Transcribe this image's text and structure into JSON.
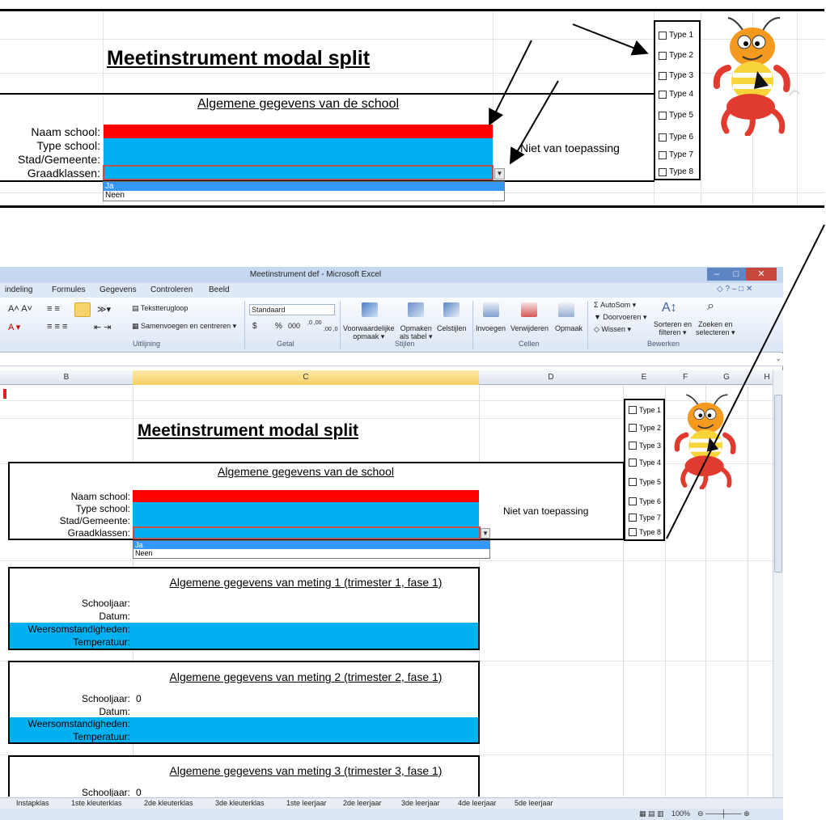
{
  "zoom": {
    "title": "Meetinstrument modal split",
    "section_title": "Algemene gegevens van de school",
    "labels": [
      "Naam school:",
      "Type school:",
      "Stad/Gemeente:",
      "Graadklassen:"
    ],
    "not_applicable": "Niet van toepassing",
    "dropdown_options": [
      "Ja",
      "Neen"
    ],
    "dropdown_arrow": "▼",
    "types": [
      "Type 1",
      "Type 2",
      "Type 3",
      "Type 4",
      "Type 5",
      "Type 6",
      "Type 7",
      "Type 8"
    ]
  },
  "window": {
    "title": "Meetinstrument def - Microsoft Excel",
    "controls": [
      "–",
      "□",
      "✕"
    ]
  },
  "menu": {
    "items": [
      "indeling",
      "Formules",
      "Gegevens",
      "Controleren",
      "Beeld"
    ]
  },
  "ribbon": {
    "wrap_text": "Tekstterugloop",
    "merge_center": "Samenvoegen en centreren",
    "number_format": "Standaard",
    "currency": "$",
    "percent": "%",
    "thousands": "000",
    "decimal_inc": ",0 ,00",
    "decimal_dec": ",00 ,0",
    "conditional_1": "Voorwaardelijke",
    "conditional_2": "opmaak",
    "format_table_1": "Opmaken",
    "format_table_2": "als tabel",
    "cell_styles": "Celstijlen",
    "insert": "Invoegen",
    "delete": "Verwijderen",
    "format": "Opmaak",
    "autosum": "AutoSom",
    "fill": "Doorvoeren",
    "clear": "Wissen",
    "sort_1": "Sorteren en",
    "sort_2": "filteren",
    "find_1": "Zoeken en",
    "find_2": "selecteren",
    "groups": [
      "Uitlijning",
      "Getal",
      "Stijlen",
      "Cellen",
      "Bewerken"
    ]
  },
  "columns": [
    "B",
    "C",
    "D",
    "E",
    "F",
    "G",
    "H"
  ],
  "sheet": {
    "title": "Meetinstrument modal split",
    "school": {
      "title": "Algemene gegevens van de school",
      "labels": [
        "Naam school:",
        "Type school:",
        "Stad/Gemeente:",
        "Graadklassen:"
      ],
      "not_applicable": "Niet van toepassing",
      "dropdown_options": [
        "Ja",
        "Neen"
      ],
      "dropdown_arrow": "▼"
    },
    "types": [
      "Type 1",
      "Type 2",
      "Type 3",
      "Type 4",
      "Type 5",
      "Type 6",
      "Type 7",
      "Type 8"
    ],
    "meting1": {
      "title": "Algemene gegevens van meting 1 (trimester 1, fase 1)",
      "labels": [
        "Schooljaar:",
        "Datum:",
        "Weersomstandigheden:",
        "Temperatuur:"
      ]
    },
    "meting2": {
      "title": "Algemene gegevens van meting 2 (trimester 2, fase 1)",
      "labels": [
        "Schooljaar:",
        "Datum:",
        "Weersomstandigheden:",
        "Temperatuur:"
      ],
      "schooljaar_value": "0"
    },
    "meting3": {
      "title": "Algemene gegevens van meting 3 (trimester 3, fase 1)",
      "labels": [
        "Schooljaar:"
      ],
      "schooljaar_value": "0"
    }
  },
  "sheet_tabs": [
    "Instapklas",
    "1ste kleuterklas",
    "2de kleuterklas",
    "3de kleuterklas",
    "1ste leerjaar",
    "2de leerjaar",
    "3de leerjaar",
    "4de leerjaar",
    "5de leerjaar"
  ],
  "status": {
    "zoom": "100%"
  }
}
